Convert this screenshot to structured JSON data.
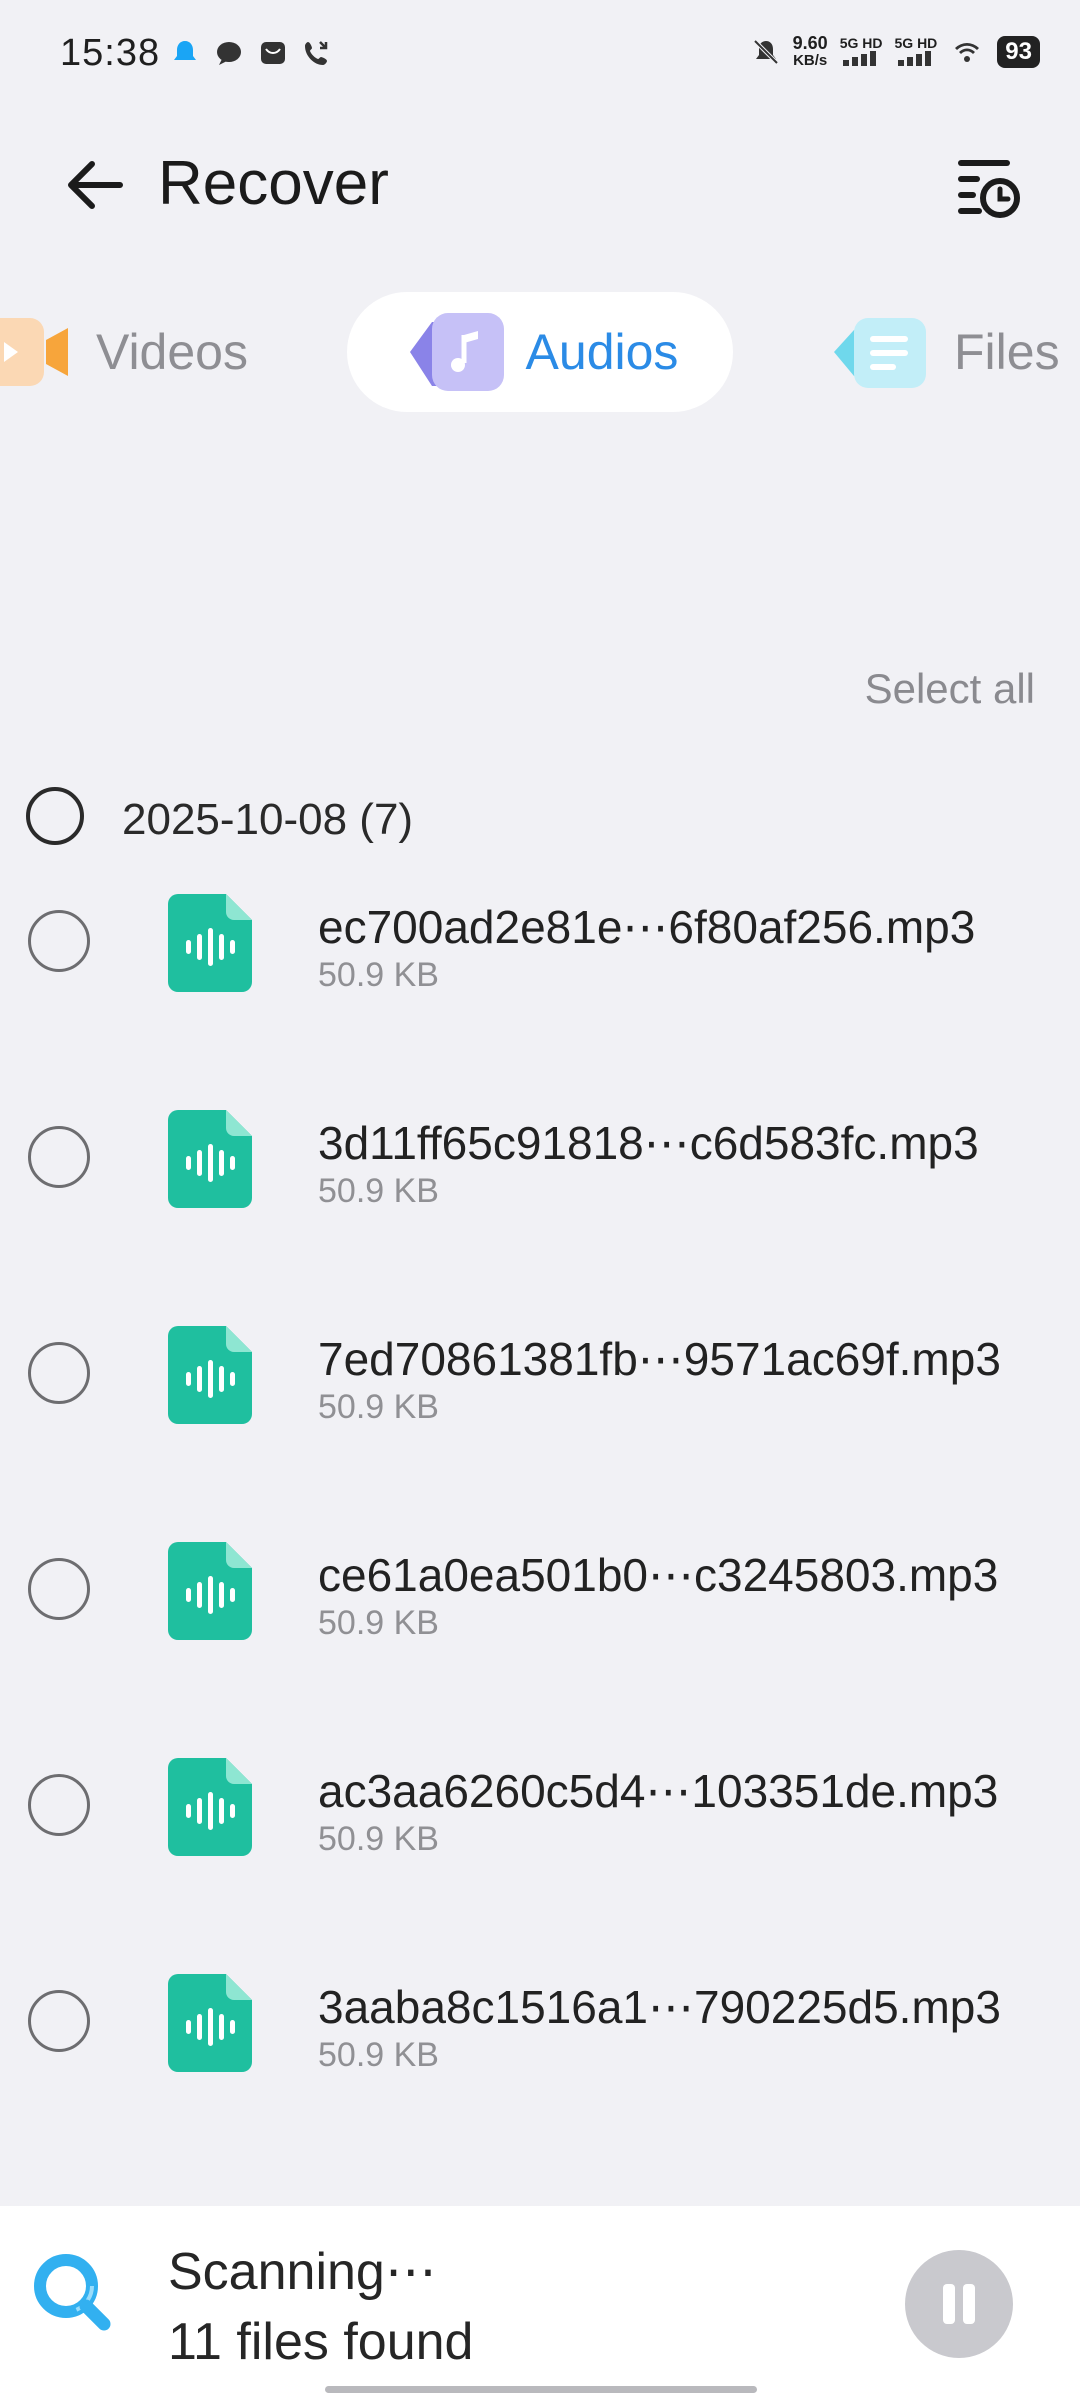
{
  "status_bar": {
    "time": "15:38",
    "speed_value": "9.60",
    "speed_unit": "KB/s",
    "network_1": "5G HD",
    "network_2": "5G HD",
    "battery": "93"
  },
  "header": {
    "title": "Recover"
  },
  "tabs": [
    {
      "label": "Videos",
      "selected": false,
      "icon": "video-icon"
    },
    {
      "label": "Audios",
      "selected": true,
      "icon": "music-note-icon"
    },
    {
      "label": "Files",
      "selected": false,
      "icon": "document-icon"
    }
  ],
  "select_all_label": "Select all",
  "group": {
    "label": "2025-10-08 (7)"
  },
  "files": [
    {
      "name": "ec700ad2e81e⋯6f80af256.mp3",
      "size": "50.9 KB"
    },
    {
      "name": "3d11ff65c91818⋯c6d583fc.mp3",
      "size": "50.9 KB"
    },
    {
      "name": "7ed70861381fb⋯9571ac69f.mp3",
      "size": "50.9 KB"
    },
    {
      "name": "ce61a0ea501b0⋯c3245803.mp3",
      "size": "50.9 KB"
    },
    {
      "name": "ac3aa6260c5d4⋯103351de.mp3",
      "size": "50.9 KB"
    },
    {
      "name": "3aaba8c1516a1⋯790225d5.mp3",
      "size": "50.9 KB"
    }
  ],
  "scan": {
    "status": "Scanning⋯",
    "count_label": "11 files found"
  },
  "colors": {
    "accent": "#2b8be6",
    "audio_icon": "#1fbf9f",
    "background": "#f1f1f5"
  }
}
